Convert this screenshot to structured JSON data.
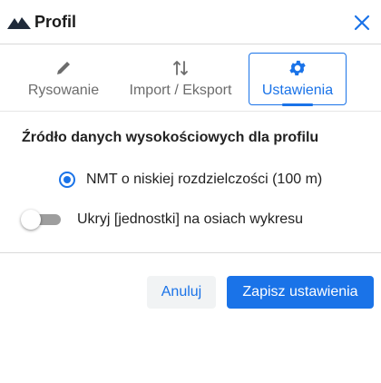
{
  "header": {
    "title": "Profil",
    "logo_icon": "mountain-icon",
    "close_icon": "close-icon"
  },
  "tabs": [
    {
      "label": "Rysowanie",
      "icon": "pencil-icon",
      "active": false
    },
    {
      "label": "Import / Eksport",
      "icon": "swap-vertical-icon",
      "active": false
    },
    {
      "label": "Ustawienia",
      "icon": "gear-icon",
      "active": true
    }
  ],
  "settings": {
    "section_title": "Źródło danych wysokościowych dla profilu",
    "radio_option": {
      "label": "NMT o niskiej rozdzielczości (100 m)",
      "checked": true
    },
    "toggle": {
      "label": "Ukryj [jednostki] na osiach wykresu",
      "on": false
    }
  },
  "buttons": {
    "cancel_label": "Anuluj",
    "save_label": "Zapisz ustawienia"
  },
  "colors": {
    "accent": "#1a73e8",
    "text": "#222222",
    "muted": "#6c6c6c"
  }
}
